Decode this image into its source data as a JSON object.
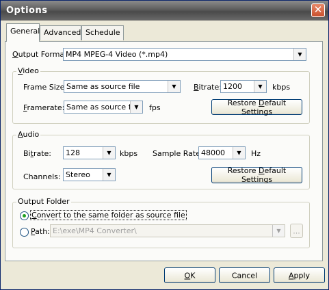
{
  "window": {
    "title": "Options",
    "close_glyph": "✕"
  },
  "tabs": [
    {
      "label": "General",
      "active": true
    },
    {
      "label": "Advanced",
      "active": false
    },
    {
      "label": "Schedule",
      "active": false
    }
  ],
  "output_format": {
    "label_u": "O",
    "label_rest": "utput Format:",
    "value": "MP4 MPEG-4 Video (*.mp4)"
  },
  "video": {
    "group_u": "V",
    "group_rest": "ideo",
    "frame_size_label": "Frame Size:",
    "frame_size_value": "Same as source file",
    "bitrate_u": "B",
    "bitrate_rest": "itrate:",
    "bitrate_value": "1200",
    "bitrate_unit": "kbps",
    "framerate_u": "F",
    "framerate_rest": "ramerate:",
    "framerate_value": "Same as source file",
    "framerate_unit": "fps",
    "restore_pre": "Restore ",
    "restore_u": "D",
    "restore_post": "efault Settings"
  },
  "audio": {
    "group_u": "A",
    "group_rest": "udio",
    "bitrate_pre": "Bi",
    "bitrate_u": "t",
    "bitrate_post": "rate:",
    "bitrate_value": "128",
    "bitrate_unit": "kbps",
    "sample_rate_label": "Sample Rate:",
    "sample_rate_value": "48000",
    "sample_rate_unit": "Hz",
    "channels_label": "Channels:",
    "channels_value": "Stereo",
    "restore_pre": "Restore ",
    "restore_u": "D",
    "restore_post": "efault Settings"
  },
  "output_folder": {
    "group_label": "Output Folder",
    "same_u": "C",
    "same_rest": "onvert to the same folder as source file",
    "same_selected": true,
    "path_u": "P",
    "path_rest": "ath:",
    "path_selected": false,
    "path_value": "E:\\exe\\MP4 Converter\\",
    "browse_label": "..."
  },
  "buttons": {
    "ok_u": "O",
    "ok_rest": "K",
    "cancel_label": "Cancel",
    "apply_u": "A",
    "apply_rest": "pply"
  },
  "icons": {
    "dropdown": "▼"
  }
}
